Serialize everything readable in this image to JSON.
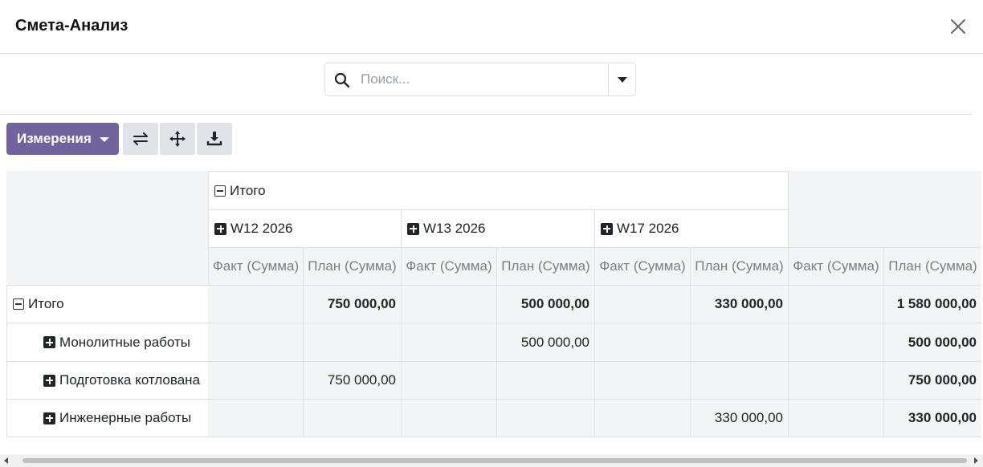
{
  "modal": {
    "title": "Смета-Анализ"
  },
  "search": {
    "placeholder": "Поиск..."
  },
  "toolbar": {
    "measures_label": "Измерения"
  },
  "icons": {
    "close": "close-icon",
    "search": "search-icon",
    "flip": "flip-axis-icon",
    "expand": "expand-all-icon",
    "download": "download-icon",
    "collapse": "minus-square-icon",
    "expand_group": "plus-square-icon"
  },
  "colors": {
    "primary": "#71639e",
    "header_bg": "#f3f4f6",
    "border": "#dee2e6"
  },
  "pivot": {
    "col_total": "Итого",
    "col_groups": [
      "W12 2026",
      "W13 2026",
      "W17 2026"
    ],
    "measures": [
      "Факт (Сумма)",
      "План (Сумма)",
      "Факт (Сумма)",
      "План (Сумма)",
      "Факт (Сумма)",
      "План (Сумма)",
      "Факт (Сумма)",
      "План (Сумма)"
    ],
    "rows": [
      {
        "label": "Итого",
        "values": [
          "",
          "750 000,00",
          "",
          "500 000,00",
          "",
          "330 000,00",
          "",
          "1 580 000,00"
        ]
      },
      {
        "label": "Монолитные работы",
        "values": [
          "",
          "",
          "",
          "500 000,00",
          "",
          "",
          "",
          "500 000,00"
        ]
      },
      {
        "label": "Подготовка котлована",
        "values": [
          "",
          "750 000,00",
          "",
          "",
          "",
          "",
          "",
          "750 000,00"
        ]
      },
      {
        "label": "Инженерные работы",
        "values": [
          "",
          "",
          "",
          "",
          "",
          "330 000,00",
          "",
          "330 000,00"
        ]
      }
    ]
  }
}
